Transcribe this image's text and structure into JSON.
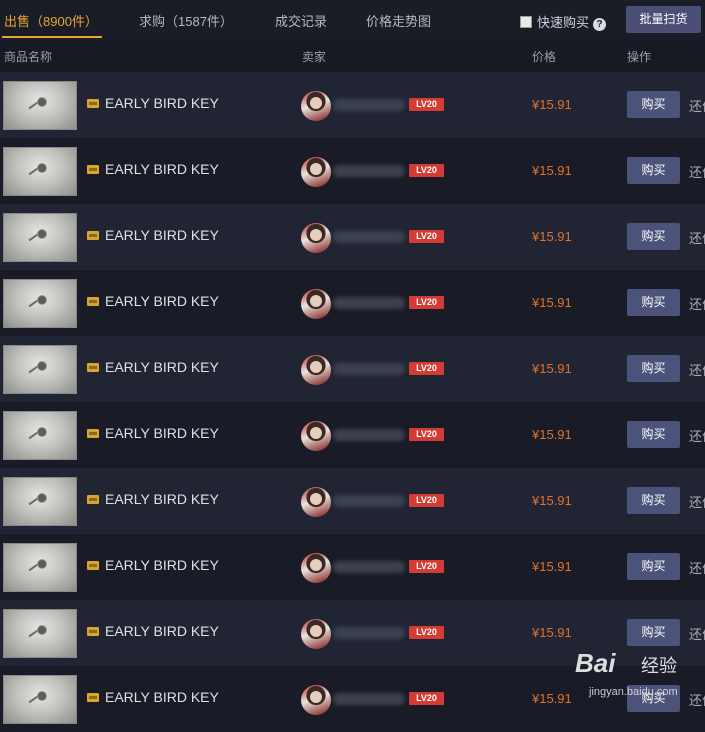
{
  "tabs": [
    {
      "label": "出售（8900件）",
      "active": true
    },
    {
      "label": "求购（1587件）",
      "active": false
    },
    {
      "label": "成交记录",
      "active": false
    },
    {
      "label": "价格走势图",
      "active": false
    }
  ],
  "toolbar": {
    "quick_buy_label": "快速购买",
    "quick_buy_checked": false,
    "help_icon": "question-circle-icon",
    "bulk_buy_label": "批量扫货"
  },
  "table": {
    "headers": {
      "item": "商品名称",
      "seller": "卖家",
      "price": "价格",
      "action": "操作"
    },
    "rows": [
      {
        "name": "EARLY BIRD KEY",
        "seller_level": "LV20",
        "price": "¥15.91",
        "buy": "购买",
        "bargain": "还价"
      },
      {
        "name": "EARLY BIRD KEY",
        "seller_level": "LV20",
        "price": "¥15.91",
        "buy": "购买",
        "bargain": "还价"
      },
      {
        "name": "EARLY BIRD KEY",
        "seller_level": "LV20",
        "price": "¥15.91",
        "buy": "购买",
        "bargain": "还价"
      },
      {
        "name": "EARLY BIRD KEY",
        "seller_level": "LV20",
        "price": "¥15.91",
        "buy": "购买",
        "bargain": "还价"
      },
      {
        "name": "EARLY BIRD KEY",
        "seller_level": "LV20",
        "price": "¥15.91",
        "buy": "购买",
        "bargain": "还价"
      },
      {
        "name": "EARLY BIRD KEY",
        "seller_level": "LV20",
        "price": "¥15.91",
        "buy": "购买",
        "bargain": "还价"
      },
      {
        "name": "EARLY BIRD KEY",
        "seller_level": "LV20",
        "price": "¥15.91",
        "buy": "购买",
        "bargain": "还价"
      },
      {
        "name": "EARLY BIRD KEY",
        "seller_level": "LV20",
        "price": "¥15.91",
        "buy": "购买",
        "bargain": "还价"
      },
      {
        "name": "EARLY BIRD KEY",
        "seller_level": "LV20",
        "price": "¥15.91",
        "buy": "购买",
        "bargain": "还价"
      },
      {
        "name": "EARLY BIRD KEY",
        "seller_level": "LV20",
        "price": "¥15.91",
        "buy": "购买",
        "bargain": "还价"
      }
    ]
  },
  "watermark": {
    "logo": "Bai",
    "text": "经验",
    "url": "jingyan.baidu.com"
  },
  "colors": {
    "accent": "#e8a432",
    "price": "#e0712f",
    "level_badge": "#d33b34",
    "button": "#4c537a"
  }
}
